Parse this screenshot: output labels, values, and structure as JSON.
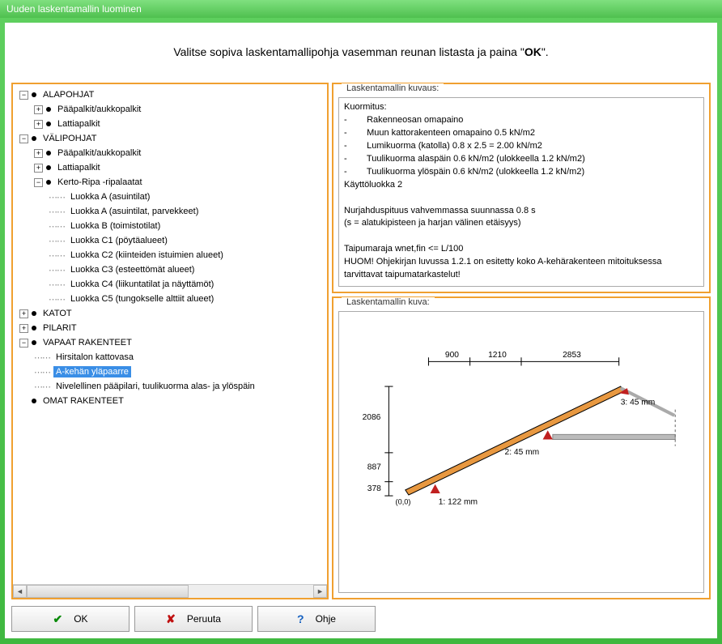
{
  "window": {
    "title": "Uuden laskentamallin luominen"
  },
  "instruction": {
    "pre": "Valitse sopiva laskentamallipohja vasemman reunan listasta ja paina \"",
    "bold": "OK",
    "post": "\"."
  },
  "tree": {
    "n0": "ALAPOHJAT",
    "n1": "Pääpalkit/aukkopalkit",
    "n2": "Lattiapalkit",
    "n3": "VÄLIPOHJAT",
    "n4": "Pääpalkit/aukkopalkit",
    "n5": "Lattiapalkit",
    "n6": "Kerto-Ripa -ripalaatat",
    "n7": "Luokka A (asuintilat)",
    "n8": "Luokka A (asuintilat, parvekkeet)",
    "n9": "Luokka B (toimistotilat)",
    "n10": "Luokka C1 (pöytäalueet)",
    "n11": "Luokka C2 (kiinteiden istuimien alueet)",
    "n12": "Luokka C3 (esteettömät alueet)",
    "n13": "Luokka C4 (liikuntatilat ja näyttämöt)",
    "n14": "Luokka C5 (tungokselle alttiit alueet)",
    "n15": "KATOT",
    "n16": "PILARIT",
    "n17": "VAPAAT RAKENTEET",
    "n18": "Hirsitalon kattovasa",
    "n19": "A-kehän yläpaarre",
    "n20": "Nivelellinen pääpilari, tuulikuorma alas- ja ylöspäin",
    "n21": "OMAT RAKENTEET"
  },
  "desc": {
    "legend": "Laskentamallin kuvaus:",
    "text": "Kuormitus:\n-        Rakenneosan omapaino\n-        Muun kattorakenteen omapaino 0.5 kN/m2\n-        Lumikuorma (katolla) 0.8 x 2.5 = 2.00 kN/m2\n-        Tuulikuorma alaspäin 0.6 kN/m2 (ulokkeella 1.2 kN/m2)\n-        Tuulikuorma ylöspäin 0.6 kN/m2 (ulokkeella 1.2 kN/m2)\nKäyttöluokka 2\n\nNurjahduspituus vahvemmassa suunnassa 0.8 s\n(s = alatukipisteen ja harjan välinen etäisyys)\n\nTaipumaraja wnet,fin <= L/100\nHUOM! Ohjekirjan luvussa 1.2.1 on esitetty koko A-kehärakenteen mitoituksessa tarvittavat taipumatarkastelut!"
  },
  "image": {
    "legend": "Laskentamallin kuva:",
    "dims": {
      "d1": "900",
      "d2": "1210",
      "d3": "2853",
      "h1": "2086",
      "h2": "887",
      "h3": "378",
      "origin": "(0,0)",
      "p1": "1: 122 mm",
      "p2": "2: 45 mm",
      "p3": "3: 45 mm"
    }
  },
  "buttons": {
    "ok": "OK",
    "cancel": "Peruuta",
    "help": "Ohje"
  }
}
